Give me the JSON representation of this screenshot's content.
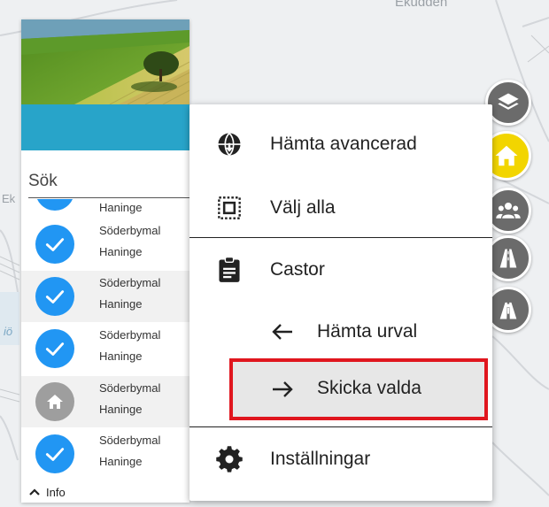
{
  "map": {
    "labels": [
      "Ekudden",
      "Ek",
      "iö"
    ]
  },
  "panel": {
    "search_placeholder": "Sök",
    "items": [
      {
        "title": "",
        "subtitle": "Haninge",
        "status": "selected"
      },
      {
        "title": "Söderbymal",
        "subtitle": "Haninge",
        "status": "selected"
      },
      {
        "title": "Söderbymal",
        "subtitle": "Haninge",
        "status": "selected"
      },
      {
        "title": "Söderbymal",
        "subtitle": "Haninge",
        "status": "selected"
      },
      {
        "title": "Söderbymal",
        "subtitle": "Haninge",
        "status": "home"
      },
      {
        "title": "Söderbymal",
        "subtitle": "Haninge",
        "status": "selected"
      }
    ],
    "info_label": "Info",
    "colors": {
      "header": "#28a4c9",
      "check": "#2196f3",
      "home": "#9e9e9e"
    }
  },
  "side_buttons": [
    {
      "icon": "layers-icon",
      "active": false
    },
    {
      "icon": "home-icon",
      "active": true
    },
    {
      "icon": "group-icon",
      "active": false
    },
    {
      "icon": "road-icon",
      "active": false
    },
    {
      "icon": "road-person-icon",
      "active": false
    }
  ],
  "menu": {
    "download_advanced": "Hämta avancerad",
    "select_all": "Välj alla",
    "castor": "Castor",
    "fetch_selection": "Hämta urval",
    "send_selected": "Skicka valda",
    "settings": "Inställningar",
    "highlight_color": "#e0161e"
  }
}
